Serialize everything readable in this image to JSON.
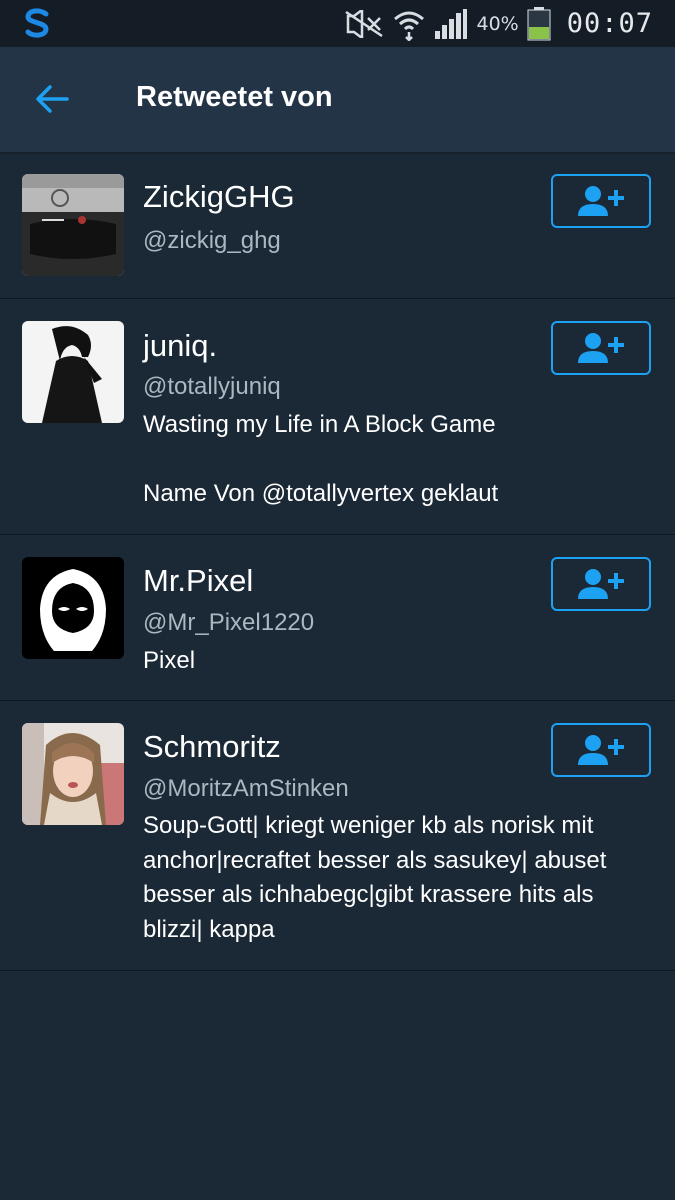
{
  "status_bar": {
    "battery_percent": "40%",
    "time": "00:07",
    "icons": [
      "app-logo-icon",
      "mute-icon",
      "wifi-icon",
      "signal-icon",
      "battery-icon"
    ]
  },
  "header": {
    "title": "Retweetet von",
    "back_icon": "back-arrow-icon"
  },
  "colors": {
    "accent": "#1da1f2",
    "background": "#1b2836",
    "header_bg": "#243447",
    "handle_text": "#aab8c2"
  },
  "users": [
    {
      "name": "ZickigGHG",
      "handle": "@zickig_ghg",
      "bio": "",
      "follow_icon": "add-user-icon"
    },
    {
      "name": "juniq.",
      "handle": "@totallyjuniq",
      "bio": "Wasting my Life in A Block Game\n\nName Von @totallyvertex geklaut",
      "follow_icon": "add-user-icon"
    },
    {
      "name": "Mr.Pixel",
      "handle": "@Mr_Pixel1220",
      "bio": "Pixel",
      "follow_icon": "add-user-icon"
    },
    {
      "name": "Schmoritz",
      "handle": "@MoritzAmStinken",
      "bio": "Soup-Gott| kriegt weniger kb als norisk mit anchor|recraftet besser als sasukey| abuset besser als ichhabegc|gibt krassere hits als blizzi| kappa",
      "follow_icon": "add-user-icon"
    }
  ]
}
